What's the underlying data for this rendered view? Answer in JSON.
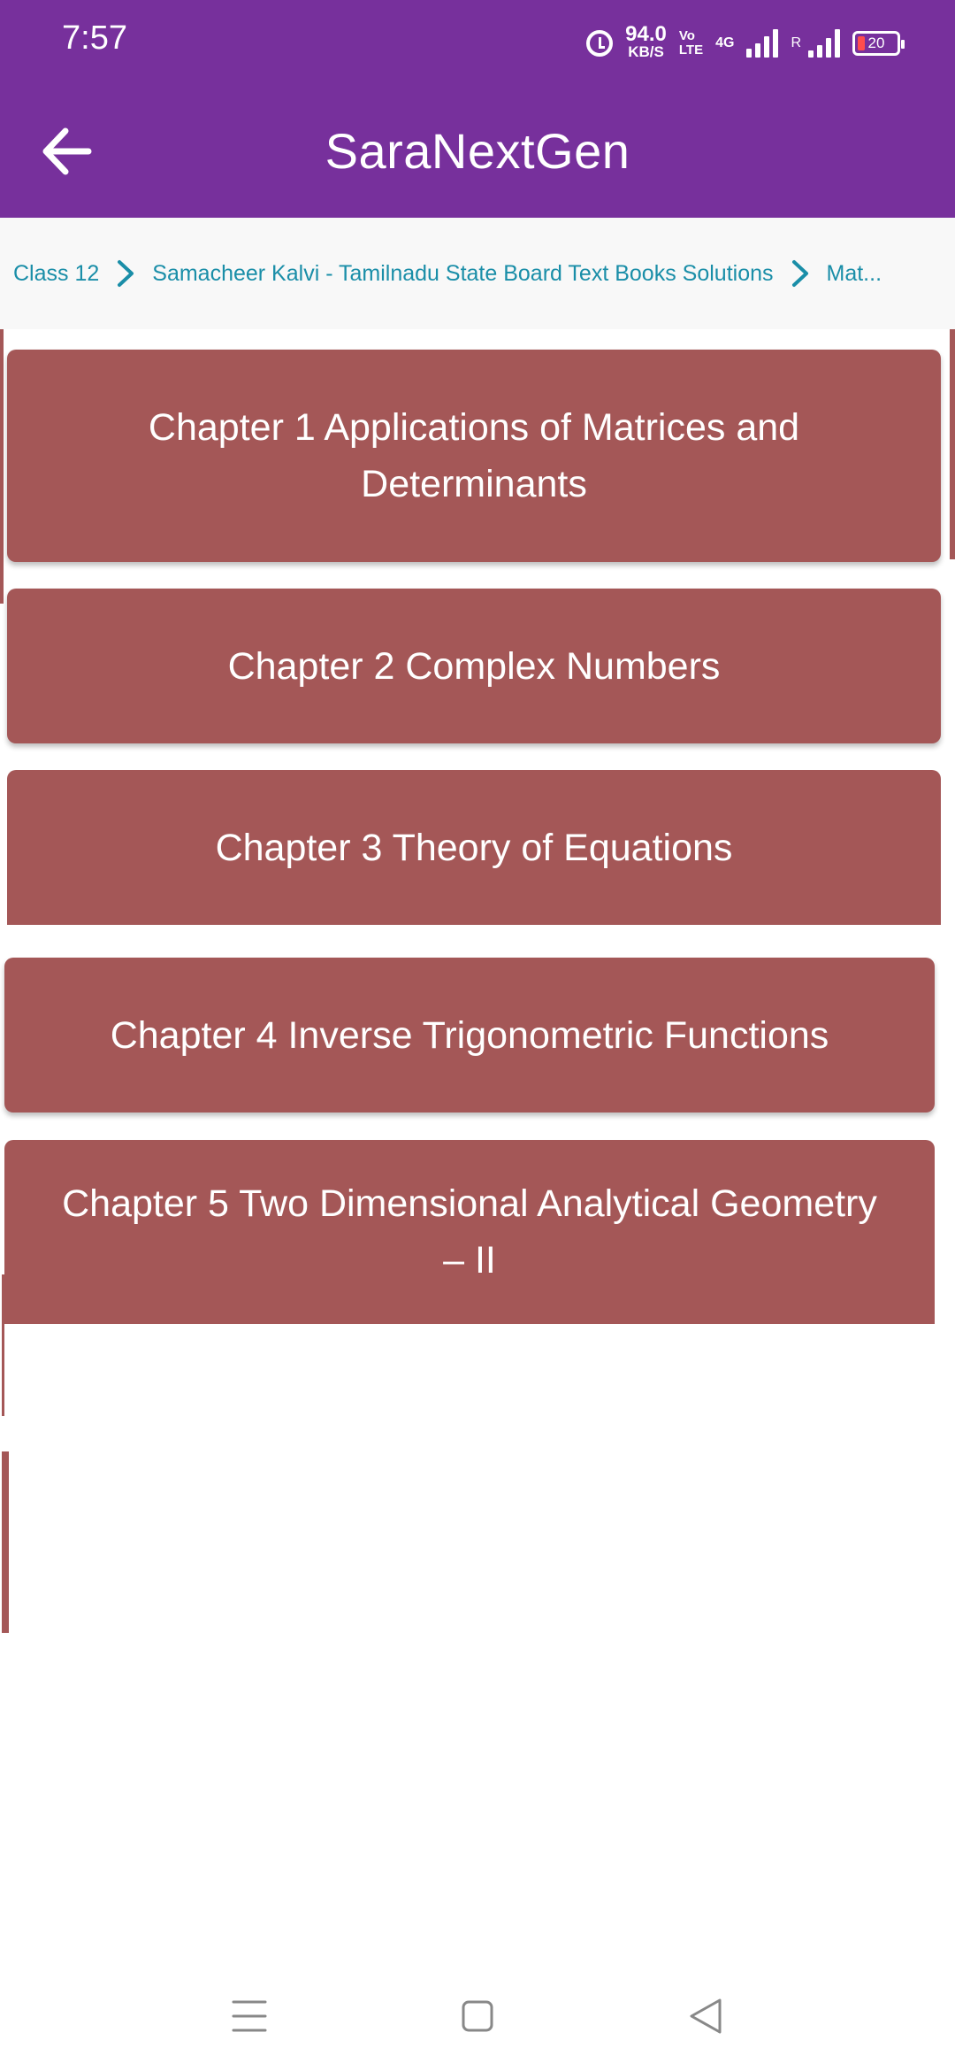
{
  "status_bar": {
    "time": "7:57",
    "net_speed_value": "94.0",
    "net_speed_unit": "KB/S",
    "volte_top": "Vo",
    "volte_bottom": "LTE",
    "network": "4G",
    "roaming": "R",
    "battery": "20",
    "icons": [
      "alarm-icon",
      "signal-icon",
      "signal-icon",
      "battery-icon"
    ]
  },
  "app_bar": {
    "title": "SaraNextGen",
    "back_icon": "arrow-left-icon"
  },
  "breadcrumb": {
    "items": [
      "Class 12",
      "Samacheer Kalvi - Tamilnadu State Board Text Books Solutions",
      "Mat..."
    ],
    "separator_icon": "chevron-right-icon"
  },
  "chapters": [
    {
      "label": "Chapter 1 Applications of Matrices and Determinants"
    },
    {
      "label": "Chapter 2 Complex Numbers"
    },
    {
      "label": "Chapter 3 Theory of Equations"
    },
    {
      "label": "Chapter 4 Inverse Trigonometric Functions"
    },
    {
      "label": "Chapter 5 Two Dimensional Analytical Geometry – II"
    }
  ],
  "nav_bar": {
    "icons": [
      "menu-icon",
      "home-square-icon",
      "back-triangle-icon"
    ]
  },
  "colors": {
    "primary": "#77309c",
    "card": "#a45757",
    "breadcrumb_text": "#1a8ea8"
  }
}
